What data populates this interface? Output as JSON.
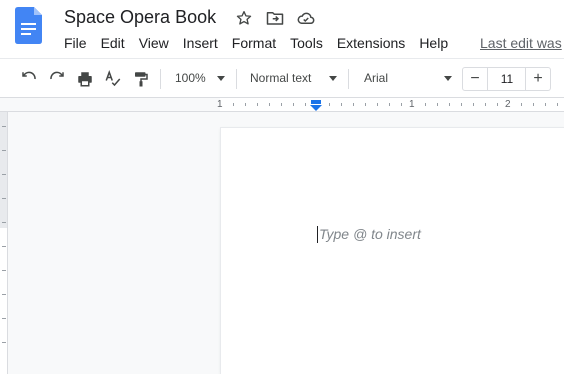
{
  "document": {
    "title": "Space Opera Book"
  },
  "menu": {
    "items": [
      "File",
      "Edit",
      "View",
      "Insert",
      "Format",
      "Tools",
      "Extensions",
      "Help"
    ],
    "last_edit": "Last edit was"
  },
  "toolbar": {
    "zoom": "100%",
    "style": "Normal text",
    "font": "Arial",
    "font_size": "11",
    "minus": "−",
    "plus": "+"
  },
  "ruler": {
    "labels": [
      "1",
      "1",
      "2"
    ]
  },
  "editor": {
    "placeholder": "Type @ to insert"
  },
  "icons": {
    "app": "docs-icon",
    "title": [
      "star-icon",
      "move-folder-icon",
      "cloud-status-icon"
    ],
    "toolbar": [
      "undo-icon",
      "redo-icon",
      "print-icon",
      "spellcheck-icon",
      "paint-format-icon"
    ]
  },
  "colors": {
    "brand_blue": "#4285f4",
    "accent_blue": "#1a73e8"
  }
}
